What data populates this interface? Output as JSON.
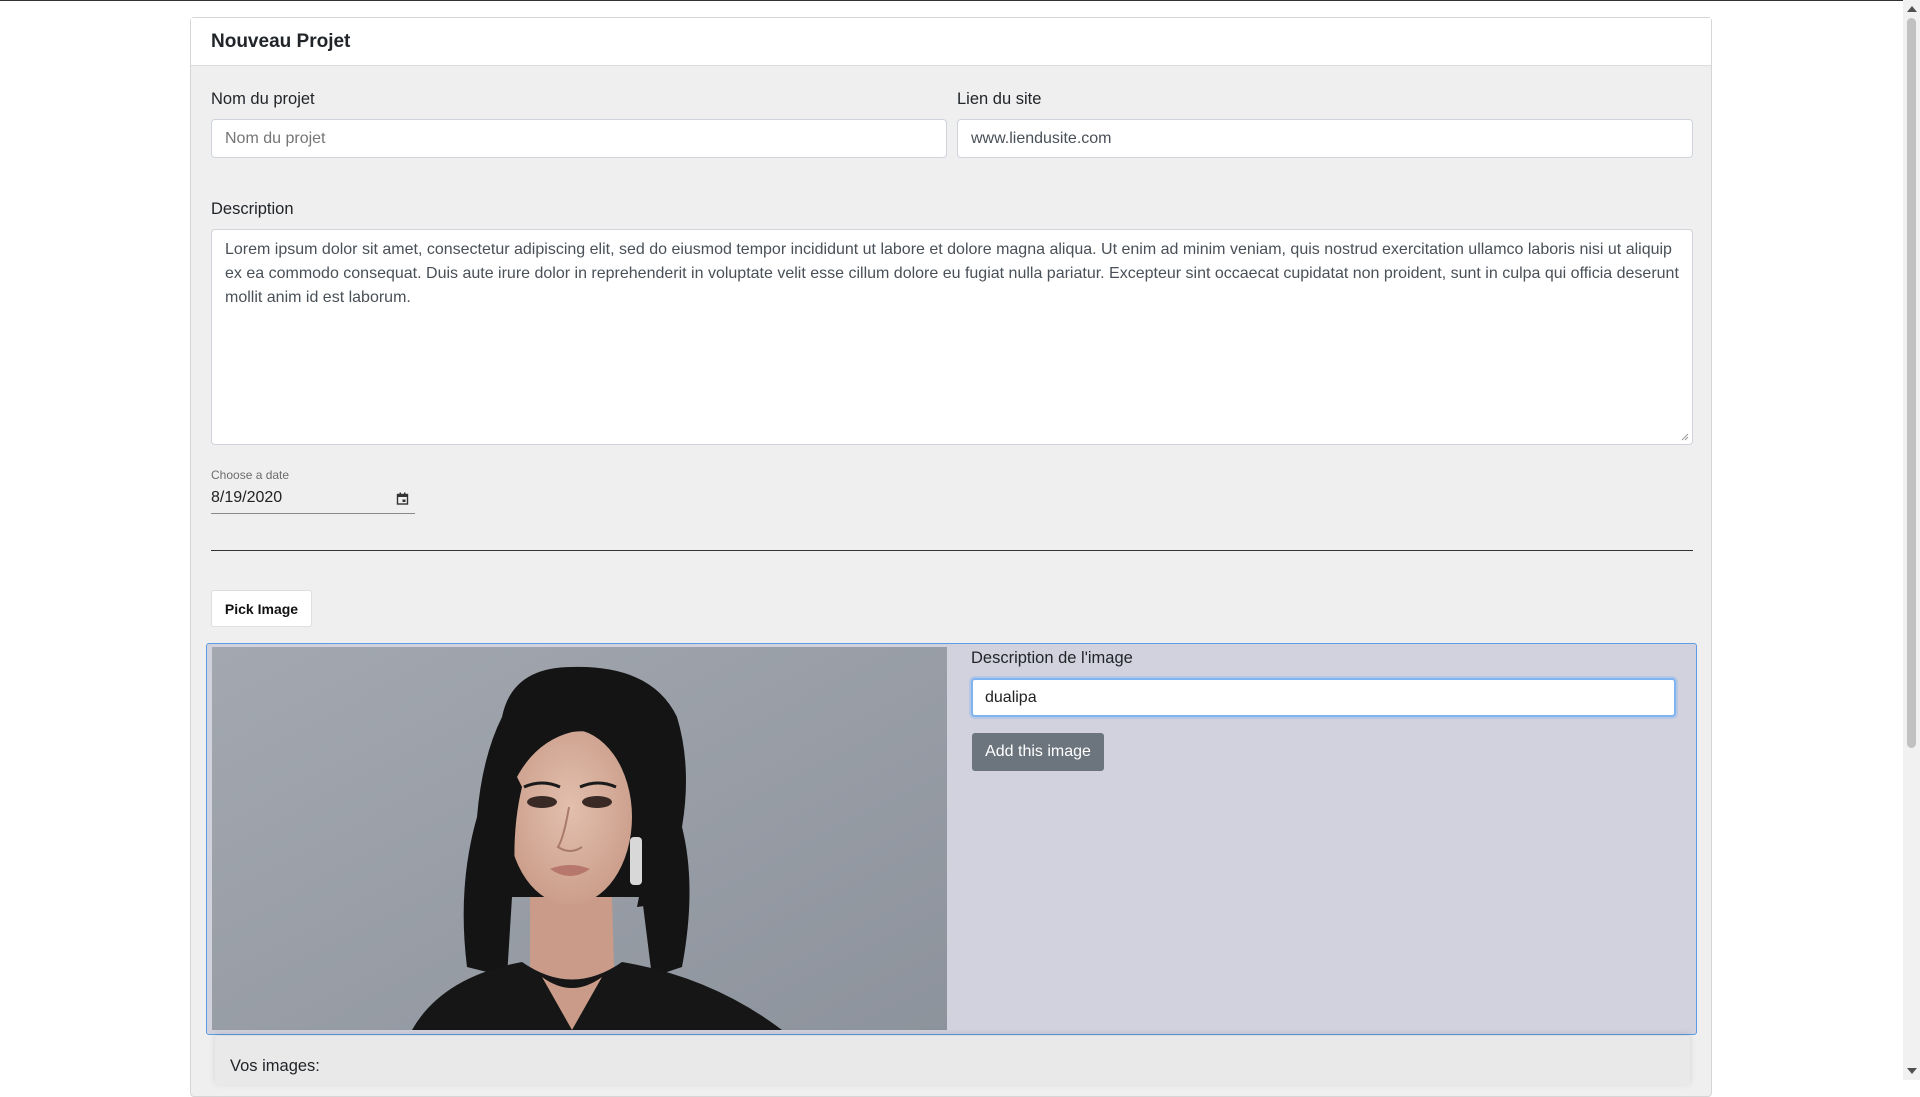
{
  "card": {
    "title": "Nouveau Projet"
  },
  "form": {
    "project_name": {
      "label": "Nom du projet",
      "placeholder": "Nom du projet",
      "value": ""
    },
    "site_link": {
      "label": "Lien du site",
      "value": "www.liendusite.com"
    },
    "description": {
      "label": "Description",
      "value": "Lorem ipsum dolor sit amet, consectetur adipiscing elit, sed do eiusmod tempor incididunt ut labore et dolore magna aliqua. Ut enim ad minim veniam, quis nostrud exercitation ullamco laboris nisi ut aliquip ex ea commodo consequat. Duis aute irure dolor in reprehenderit in voluptate velit esse cillum dolore eu fugiat nulla pariatur. Excepteur sint occaecat cupidatat non proident, sunt in culpa qui officia deserunt mollit anim id est laborum."
    },
    "date": {
      "label": "Choose a date",
      "value": "8/19/2020",
      "icon": "calendar-icon"
    }
  },
  "image_picker": {
    "pick_label": "Pick Image",
    "description_label": "Description de l'image",
    "description_value": "dualipa",
    "add_label": "Add this image"
  },
  "gallery": {
    "label": "Vos images:"
  },
  "colors": {
    "accent_border": "#5c9ce6",
    "panel_bg": "#d2d2de",
    "button_secondary": "#6c757d"
  }
}
